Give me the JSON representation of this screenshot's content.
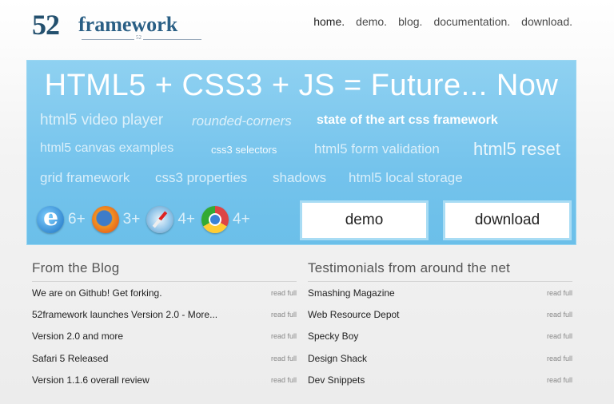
{
  "header": {
    "logo_number": "52",
    "logo_word": "framework",
    "logo_sub": "52",
    "nav": [
      "home.",
      "demo.",
      "blog.",
      "documentation.",
      "download."
    ]
  },
  "hero": {
    "headline": "HTML5  +  CSS3  + JS = Future... Now",
    "tags": [
      "html5 video player",
      "rounded-corners",
      "state of the art css framework",
      "html5 canvas examples",
      "css3 selectors",
      "html5 form validation",
      "html5 reset",
      "grid framework",
      "css3 properties",
      "shadows",
      "html5 local storage"
    ],
    "browsers": [
      {
        "icon": "ie-icon",
        "version": "6+"
      },
      {
        "icon": "firefox-icon",
        "version": "3+"
      },
      {
        "icon": "safari-icon",
        "version": "4+"
      },
      {
        "icon": "chrome-icon",
        "version": "4+"
      }
    ],
    "demo_label": "demo",
    "download_label": "download"
  },
  "blog": {
    "title": "From the Blog",
    "read_more": "read full",
    "items": [
      "We are on Github! Get forking.",
      "52framework launches Version 2.0 - More...",
      "Version 2.0 and more",
      "Safari 5 Released",
      "Version 1.1.6 overall review"
    ]
  },
  "testimonials": {
    "title": "Testimonials from around the net",
    "read_more": "read full",
    "items": [
      "Smashing Magazine",
      "Web Resource Depot",
      "Specky Boy",
      "Design Shack",
      "Dev Snippets"
    ]
  },
  "colors": {
    "hero_blue": "#74c3ec",
    "logo_navy": "#23506e"
  }
}
